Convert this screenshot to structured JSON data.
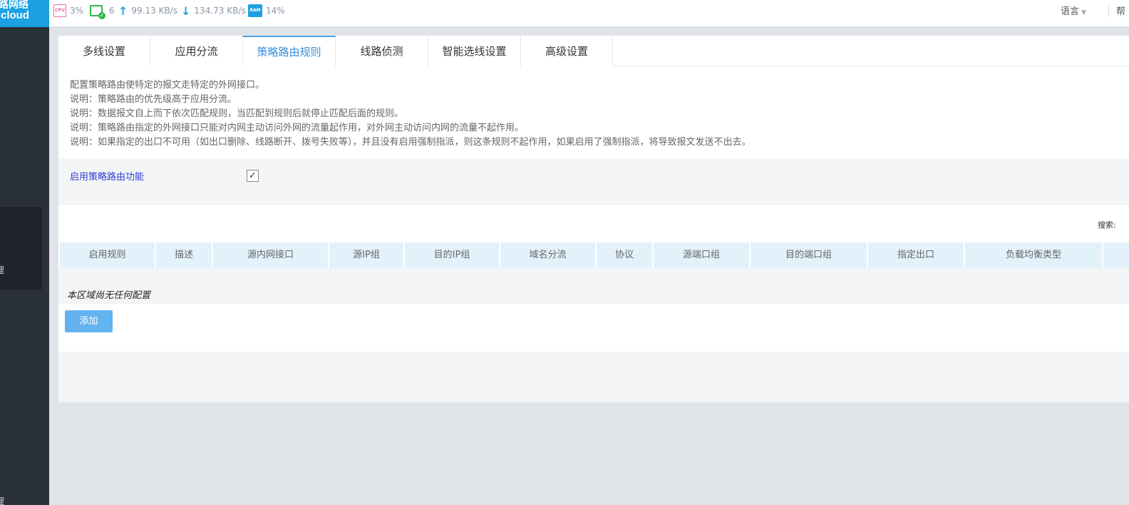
{
  "sidebar": {
    "logo_line1": "路网络",
    "logo_line2": "cloud",
    "active_item_fragment": "理",
    "bottom_item_fragment": "理"
  },
  "topbar": {
    "cpu_icon": "CPU",
    "cpu_value": "3%",
    "online_count": "6",
    "upload": "99.13 KB/s",
    "download": "134.73 KB/s",
    "ram_icon": "RAM",
    "ram_value": "14%",
    "language": "语言",
    "help": "帮"
  },
  "tabs": [
    {
      "label": "多线设置"
    },
    {
      "label": "应用分流"
    },
    {
      "label": "策略路由规则"
    },
    {
      "label": "线路侦测"
    },
    {
      "label": "智能选线设置"
    },
    {
      "label": "高级设置"
    }
  ],
  "description": [
    "配置策略路由使特定的报文走特定的外网接口。",
    "说明：策略路由的优先级高于应用分流。",
    "说明：数据报文自上而下依次匹配规则，当匹配到规则后就停止匹配后面的规则。",
    "说明：策略路由指定的外网接口只能对内网主动访问外网的流量起作用，对外网主动访问内网的流量不起作用。",
    "说明：如果指定的出口不可用（如出口删除、线路断开、拨号失败等），并且没有启用强制指派，则这条规则不起作用，如果启用了强制指派，将导致报文发送不出去。"
  ],
  "enable": {
    "label": "启用策略路由功能",
    "checked": true,
    "check_mark": "✓"
  },
  "table": {
    "search_label": "搜索:",
    "columns": [
      "启用规则",
      "描述",
      "源内网接口",
      "源IP组",
      "目的IP组",
      "域名分流",
      "协议",
      "源端口组",
      "目的端口组",
      "指定出口",
      "负载均衡类型"
    ],
    "empty_text": "本区域尚无任何配置",
    "add_label": "添加"
  },
  "colors": {
    "accent": "#3a8fd9",
    "logo_bg": "#1ba1e2",
    "sidebar_bg": "#2b3139",
    "header_bg": "#e3f1fb",
    "button_bg": "#62b3f0",
    "enable_label": "#2c3fd4"
  }
}
